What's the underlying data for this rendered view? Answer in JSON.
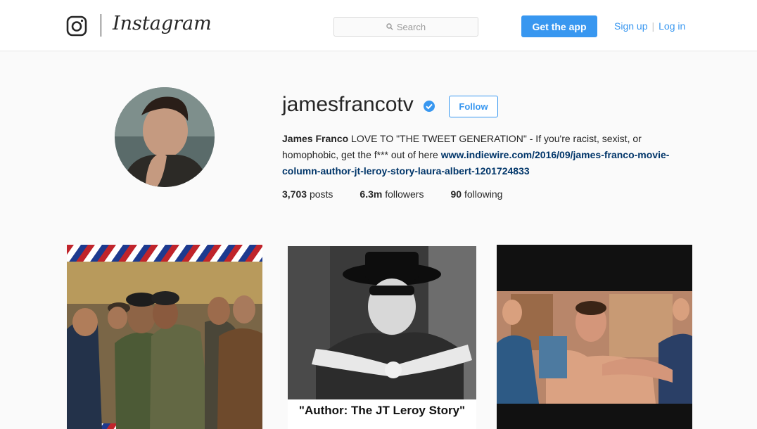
{
  "header": {
    "brand": "Instagram",
    "search_placeholder": "Search",
    "get_app_label": "Get the app",
    "signup_label": "Sign up",
    "separator": "|",
    "login_label": "Log in"
  },
  "profile": {
    "username": "jamesfrancotv",
    "follow_label": "Follow",
    "full_name": "James Franco",
    "bio_text": " LOVE TO \"THE TWEET GENERATION\" - If you're racist, sexist, or homophobic, get the f*** out of here ",
    "bio_link": "www.indiewire.com/2016/09/james-franco-movie-column-author-jt-leroy-story-laura-albert-1201724833",
    "stats": {
      "posts_count": "3,703",
      "posts_label": "posts",
      "followers_count": "6.3m",
      "followers_label": "followers",
      "following_count": "90",
      "following_label": "following"
    }
  },
  "posts": [
    {
      "caption": ""
    },
    {
      "caption": "\"Author: The JT Leroy Story\""
    },
    {
      "caption": ""
    }
  ],
  "colors": {
    "accent": "#3897f0",
    "link": "#003569",
    "background": "#fafafa"
  },
  "icons": [
    "instagram-logo-icon",
    "search-icon",
    "verified-badge-icon"
  ]
}
